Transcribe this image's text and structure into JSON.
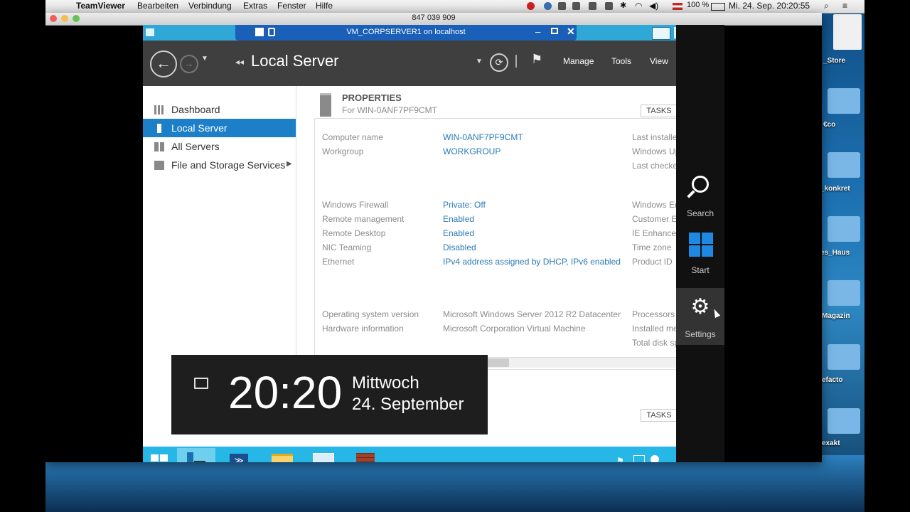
{
  "mac_menubar": {
    "app_name": "TeamViewer",
    "menus": [
      "Bearbeiten",
      "Verbindung",
      "Extras",
      "Fenster",
      "Hilfe"
    ],
    "battery": "100 %",
    "clock": "Mi. 24. Sep.  20:20:55"
  },
  "teamviewer": {
    "window_title": "847 039 909"
  },
  "vm_window": {
    "title": "VM_CORPSERVER1 on localhost"
  },
  "server_manager": {
    "breadcrumb": "Local Server",
    "menu": [
      "Manage",
      "Tools",
      "View"
    ],
    "nav": [
      "Dashboard",
      "Local Server",
      "All Servers",
      "File and Storage Services"
    ],
    "properties_title": "PROPERTIES",
    "properties_subtitle": "For WIN-0ANF7PF9CMT",
    "tasks_label": "TASKS",
    "rows_group1": [
      {
        "key": "Computer name",
        "value": "WIN-0ANF7PF9CMT",
        "right": "Last installe"
      },
      {
        "key": "Workgroup",
        "value": "WORKGROUP",
        "right": "Windows Up"
      },
      {
        "key": "",
        "value": "",
        "right": "Last checke"
      }
    ],
    "rows_group2": [
      {
        "key": "Windows Firewall",
        "value": "Private: Off",
        "right": "Windows Er"
      },
      {
        "key": "Remote management",
        "value": "Enabled",
        "right": "Customer E"
      },
      {
        "key": "Remote Desktop",
        "value": "Enabled",
        "right": "IE Enhanced"
      },
      {
        "key": "NIC Teaming",
        "value": "Disabled",
        "right": "Time zone"
      },
      {
        "key": "Ethernet",
        "value": "IPv4 address assigned by DHCP, IPv6 enabled",
        "right": "Product ID"
      }
    ],
    "rows_group3": [
      {
        "key": "Operating system version",
        "value": "Microsoft Windows Server 2012 R2 Datacenter",
        "right": "Processors"
      },
      {
        "key": "Hardware information",
        "value": "Microsoft Corporation Virtual Machine",
        "right": "Installed me"
      },
      {
        "key": "",
        "value": "",
        "right": "Total disk sp"
      }
    ]
  },
  "clock_overlay": {
    "time": "20:20",
    "weekday": "Mittwoch",
    "date": "24. September"
  },
  "charms": [
    "Search",
    "Start",
    "Settings"
  ],
  "desktop_icons": [
    "_Store",
    "€co",
    "_konkret",
    "es_Haus",
    "Magazin",
    "efacto",
    "exakt"
  ],
  "colors": {
    "taskbar": "#26b7e6",
    "selection": "#1c7fc7",
    "link": "#2a7ab8",
    "header": "#3f3f3f"
  }
}
